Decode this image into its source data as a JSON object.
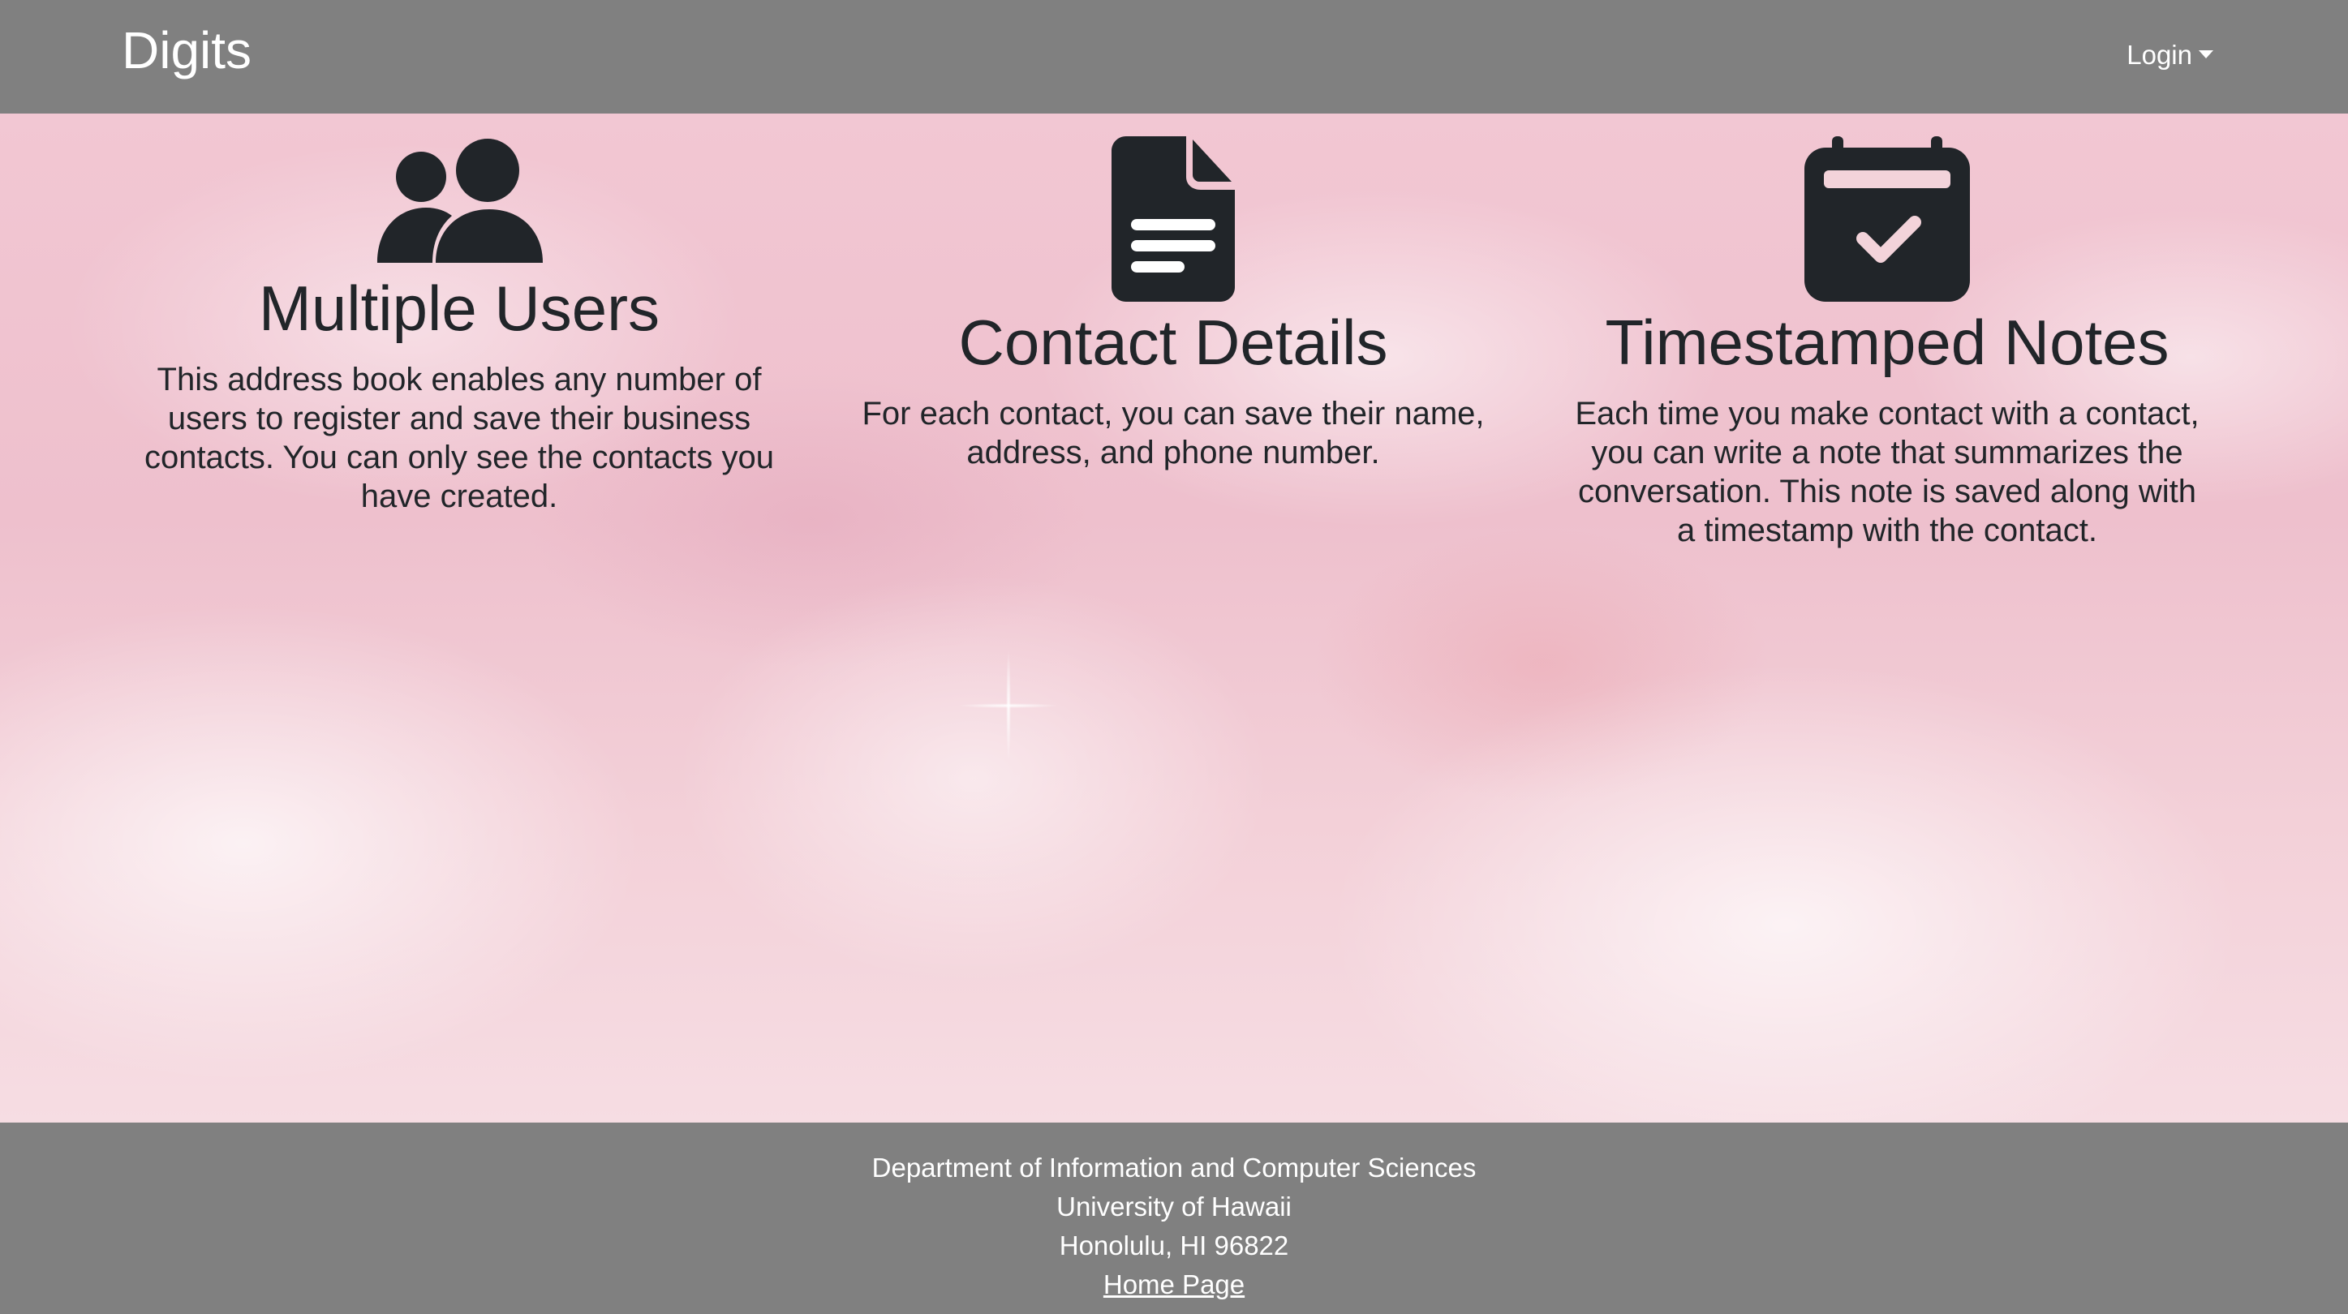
{
  "navbar": {
    "brand": "Digits",
    "login_label": "Login"
  },
  "features": [
    {
      "icon": "users-icon",
      "title": "Multiple Users",
      "text": "This address book enables any number of users to register and save their business contacts. You can only see the contacts you have created."
    },
    {
      "icon": "file-alt-icon",
      "title": "Contact Details",
      "text": "For each contact, you can save their name, address, and phone number."
    },
    {
      "icon": "calendar-check-icon",
      "title": "Timestamped Notes",
      "text": "Each time you make contact with a contact, you can write a note that summarizes the conversation. This note is saved along with a timestamp with the contact."
    }
  ],
  "footer": {
    "line1": "Department of Information and Computer Sciences",
    "line2": "University of Hawaii",
    "line3": "Honolulu, HI 96822",
    "link": "Home Page"
  },
  "colors": {
    "navbar_bg": "#808080",
    "footer_bg": "#808080",
    "text_dark": "#212529",
    "text_light": "#ffffff"
  }
}
